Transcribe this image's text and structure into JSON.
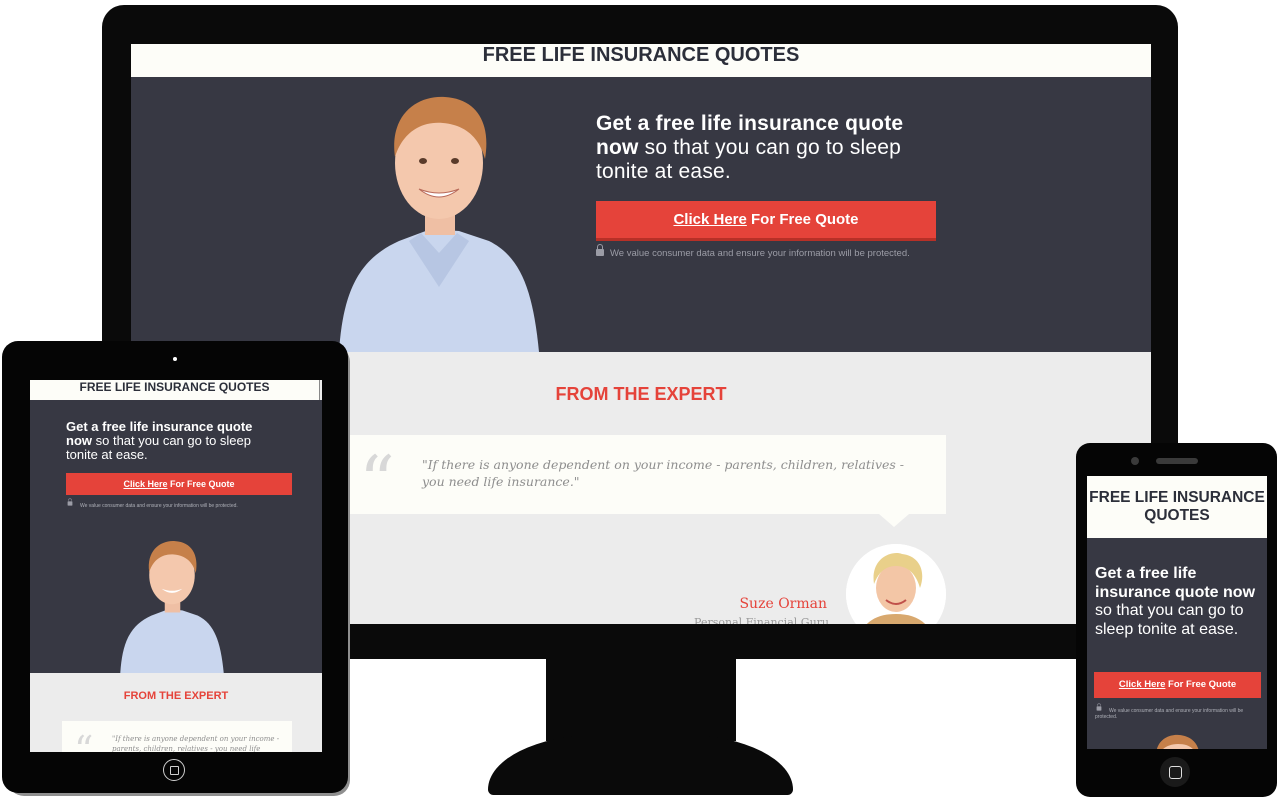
{
  "page": {
    "title": "FREE LIFE INSURANCE QUOTES",
    "headline_bold": "Get a free life insurance quote now",
    "headline_rest": " so that you can go to sleep tonite at ease.",
    "cta_link": "Click Here",
    "cta_rest": " For Free Quote",
    "secure_note": "We value consumer data and ensure your information will be protected.",
    "expert_heading": "FROM THE EXPERT",
    "quote_mark": "“",
    "quote": "\"If there is anyone dependent on your income - parents, children, relatives - you need life insurance.\"",
    "expert_name": "Suze Orman",
    "expert_role": "Personal Financial Guru"
  },
  "colors": {
    "hero_bg": "#373843",
    "accent": "#e5433a",
    "header_bg": "#fdfdf8",
    "section_bg": "#ececec",
    "device_frame": "#0a0a0a"
  },
  "icons": [
    "lock-icon",
    "quote-icon",
    "home-button-icon"
  ]
}
